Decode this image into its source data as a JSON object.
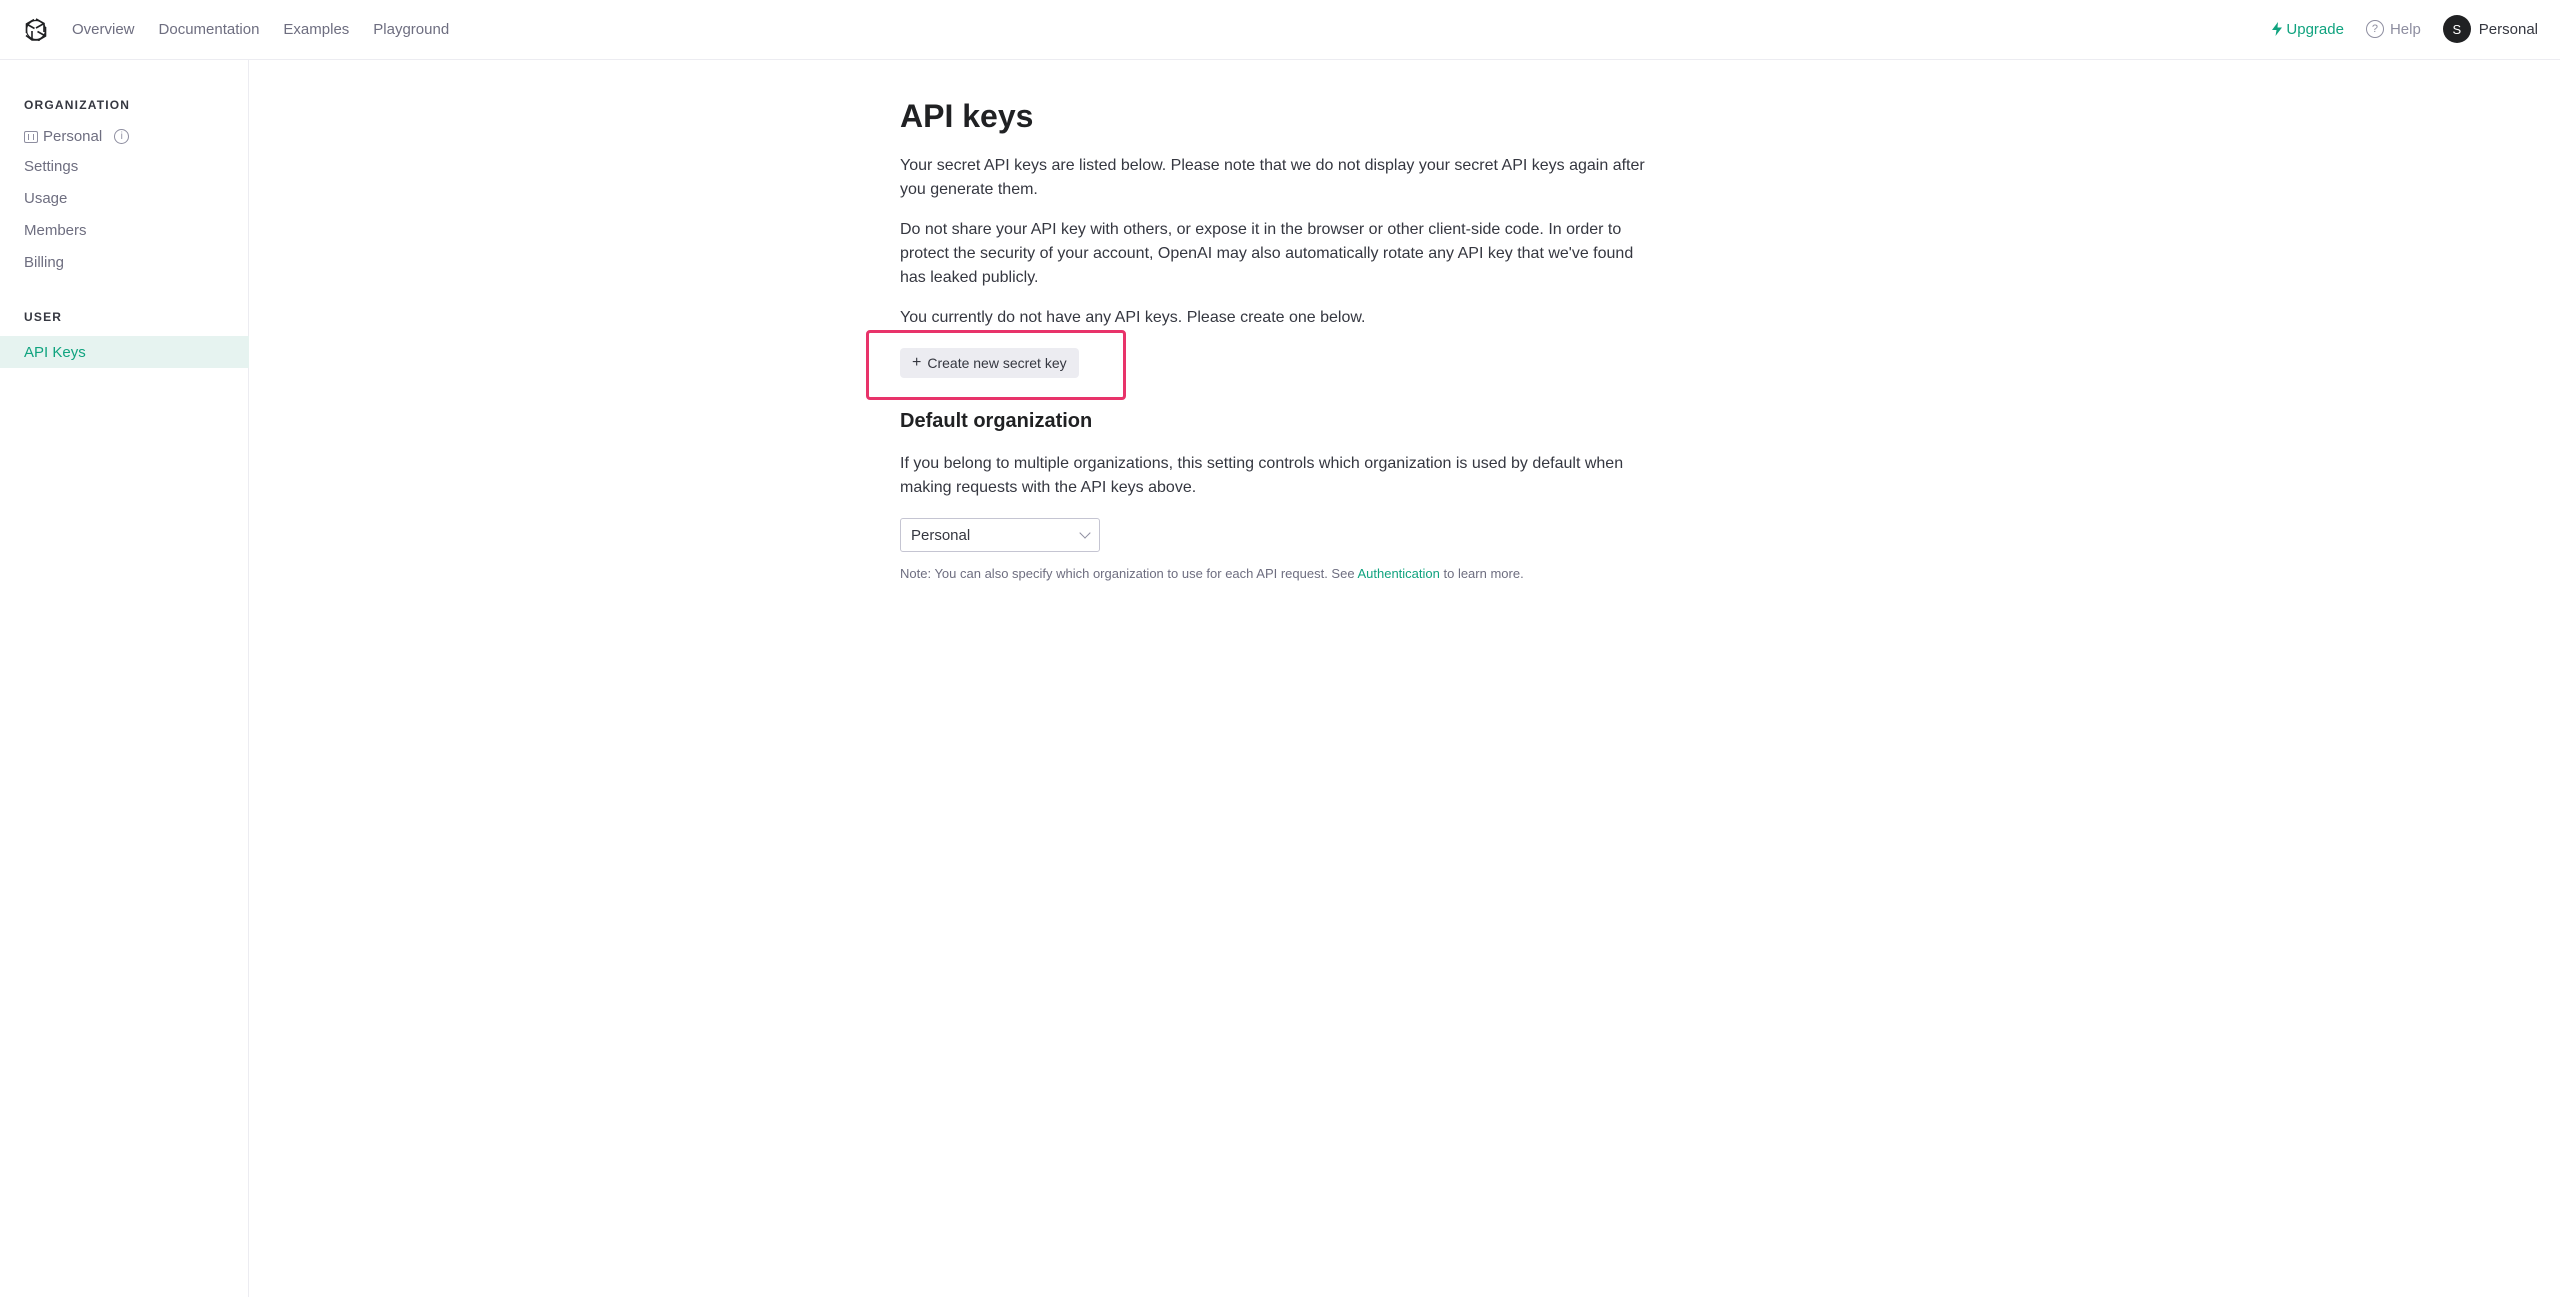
{
  "nav": {
    "links": [
      "Overview",
      "Documentation",
      "Examples",
      "Playground"
    ],
    "upgrade_label": "Upgrade",
    "help_label": "Help",
    "profile_initial": "S",
    "profile_label": "Personal"
  },
  "sidebar": {
    "org_heading": "ORGANIZATION",
    "org_name": "Personal",
    "org_items": [
      "Settings",
      "Usage",
      "Members",
      "Billing"
    ],
    "user_heading": "USER",
    "active_item": "API Keys"
  },
  "main": {
    "title": "API keys",
    "intro": "Your secret API keys are listed below. Please note that we do not display your secret API keys again after you generate them.",
    "warning": "Do not share your API key with others, or expose it in the browser or other client-side code. In order to protect the security of your account, OpenAI may also automatically rotate any API key that we've found has leaked publicly.",
    "empty_state": "You currently do not have any API keys. Please create one below.",
    "create_button": "Create new secret key",
    "default_org_title": "Default organization",
    "default_org_desc": "If you belong to multiple organizations, this setting controls which organization is used by default when making requests with the API keys above.",
    "org_select_value": "Personal",
    "note_prefix": "Note: You can also specify which organization to use for each API request. See ",
    "note_link": "Authentication",
    "note_suffix": " to learn more."
  },
  "colors": {
    "accent": "#10a37f",
    "highlight_box": "#e8336a"
  }
}
